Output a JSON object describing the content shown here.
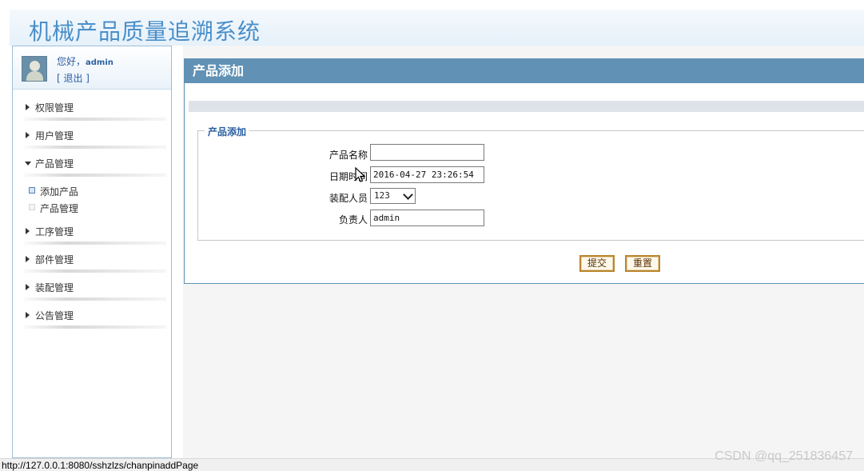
{
  "header": {
    "title": "机械产品质量追溯系统"
  },
  "user": {
    "greeting": "您好，",
    "name": "admin",
    "logout": "[ 退出 ]"
  },
  "menu": {
    "items": [
      {
        "label": "权限管理"
      },
      {
        "label": "用户管理"
      },
      {
        "label": "产品管理"
      },
      {
        "label": "工序管理"
      },
      {
        "label": "部件管理"
      },
      {
        "label": "装配管理"
      },
      {
        "label": "公告管理"
      }
    ],
    "submenu": [
      {
        "label": "添加产品"
      },
      {
        "label": "产品管理"
      }
    ]
  },
  "panel": {
    "title": "产品添加",
    "legend": "产品添加",
    "fields": {
      "name_label": "产品名称",
      "name_value": "",
      "date_label": "日期时间",
      "date_value": "2016-04-27 23:26:54",
      "assembler_label": "装配人员",
      "assembler_value": "123",
      "owner_label": "负责人",
      "owner_value": "admin"
    },
    "submit_label": "提交",
    "reset_label": "重置"
  },
  "status": {
    "url": "http://127.0.0.1:8080/sshzlzs/chanpinaddPage"
  },
  "watermark": "CSDN @qq_251836457"
}
